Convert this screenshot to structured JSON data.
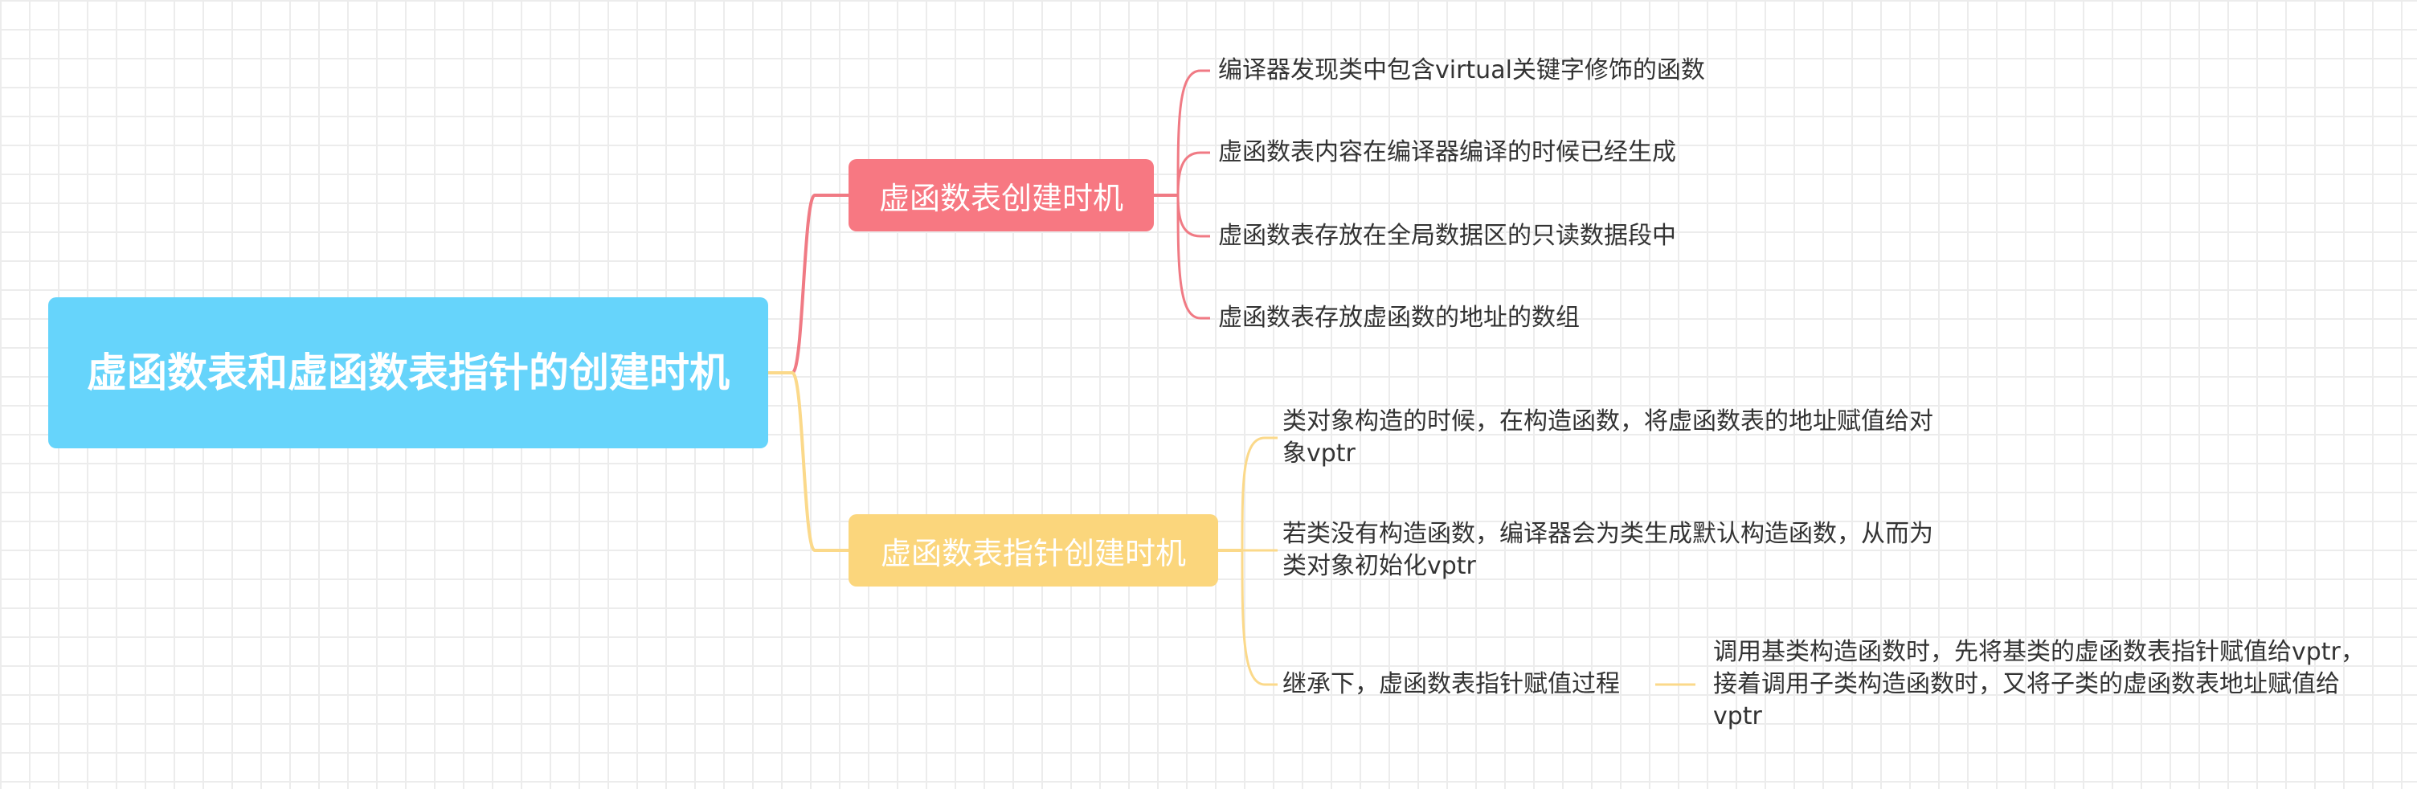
{
  "colors": {
    "root": "#66d4fb",
    "branch_a": "#f77882",
    "branch_b": "#fbd67c",
    "line_a": "#f07a84",
    "line_b": "#fbd98a",
    "text": "#333333"
  },
  "root": {
    "label": "虚函数表和虚函数表指针的创建时机"
  },
  "branches": [
    {
      "label": "虚函数表创建时机",
      "children": [
        {
          "label": "编译器发现类中包含virtual关键字修饰的函数"
        },
        {
          "label": "虚函数表内容在编译器编译的时候已经生成"
        },
        {
          "label": "虚函数表存放在全局数据区的只读数据段中"
        },
        {
          "label": "虚函数表存放虚函数的地址的数组"
        }
      ]
    },
    {
      "label": "虚函数表指针创建时机",
      "children": [
        {
          "label": "类对象构造的时候，在构造函数，将虚函数表的地址赋值给对象vptr"
        },
        {
          "label": "若类没有构造函数，编译器会为类生成默认构造函数，从而为类对象初始化vptr"
        },
        {
          "label": "继承下，虚函数表指针赋值过程",
          "children": [
            {
              "label": "调用基类构造函数时，先将基类的虚函数表指针赋值给vptr，接着调用子类构造函数时，又将子类的虚函数表地址赋值给vptr"
            }
          ]
        }
      ]
    }
  ]
}
